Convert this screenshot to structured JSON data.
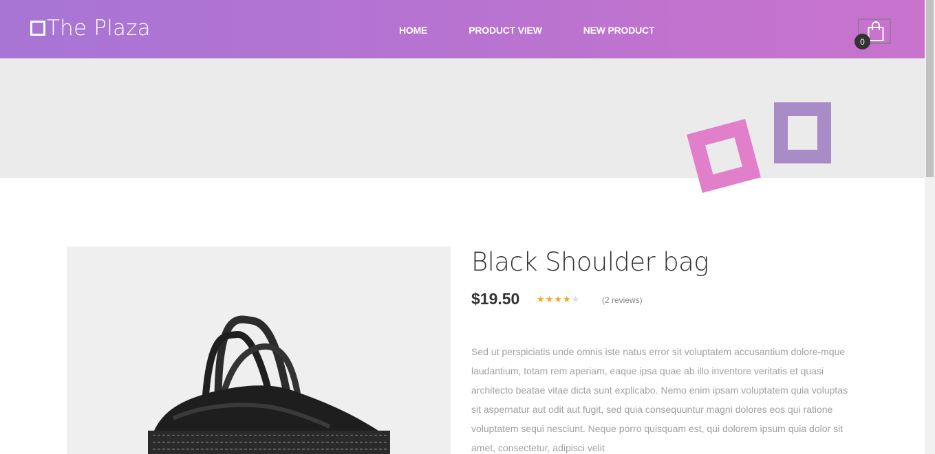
{
  "header": {
    "logo_text": "The Plaza",
    "nav": [
      "HOME",
      "PRODUCT VIEW",
      "NEW PRODUCT"
    ],
    "cart_count": "0"
  },
  "product": {
    "title": "Black Shoulder bag",
    "price": "$19.50",
    "rating": 4,
    "rating_max": 5,
    "reviews": "(2 reviews)",
    "description": "Sed ut perspiciatis unde omnis iste natus error sit voluptatem accusantium dolore-mque laudantium, totam rem aperiam, eaque ipsa quae ab illo inventore veritatis et quasi architecto beatae vitae dicta sunt explicabo. Nemo enim ipsam voluptatem quia voluptas sit aspernatur aut odit aut fugit, sed quia consequuntur magni dolores eos qui ratione voluptatem sequi nesciunt. Neque porro quisquam est, qui dolorem ipsum quia dolor sit amet, consectetur, adipisci velit"
  },
  "colors": {
    "header_gradient_start": "#a775d5",
    "header_gradient_end": "#c973cd",
    "star_filled": "#f5a623",
    "star_empty": "#dddddd",
    "deco_pink": "#e27fcb",
    "deco_purple": "#a98bc7"
  },
  "icons": {
    "cart": "shopping-bag-icon",
    "logo": "square-outline-icon",
    "star": "star-icon"
  }
}
